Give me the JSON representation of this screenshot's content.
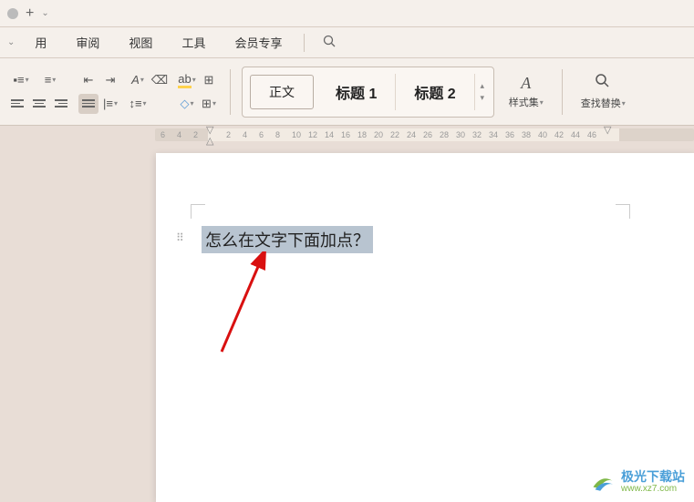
{
  "titlebar": {
    "plus_tooltip": "+"
  },
  "menubar": {
    "items": [
      "用",
      "审阅",
      "视图",
      "工具",
      "会员专享"
    ]
  },
  "toolbar": {
    "styles": {
      "body": "正文",
      "heading1": "标题 1",
      "heading2": "标题 2"
    },
    "styleset_label": "样式集",
    "find_replace_label": "查找替换"
  },
  "ruler": {
    "ticks_left": [
      "6",
      "4",
      "2"
    ],
    "ticks_right": [
      "2",
      "4",
      "6",
      "8",
      "10",
      "12",
      "14",
      "16",
      "18",
      "20",
      "22",
      "24",
      "26",
      "28",
      "30",
      "32",
      "34",
      "36",
      "38",
      "40",
      "42",
      "44",
      "46"
    ]
  },
  "document": {
    "text": "怎么在文字下面加点？"
  },
  "watermark": {
    "name_cn": "极光下载站",
    "url": "www.xz7.com"
  }
}
